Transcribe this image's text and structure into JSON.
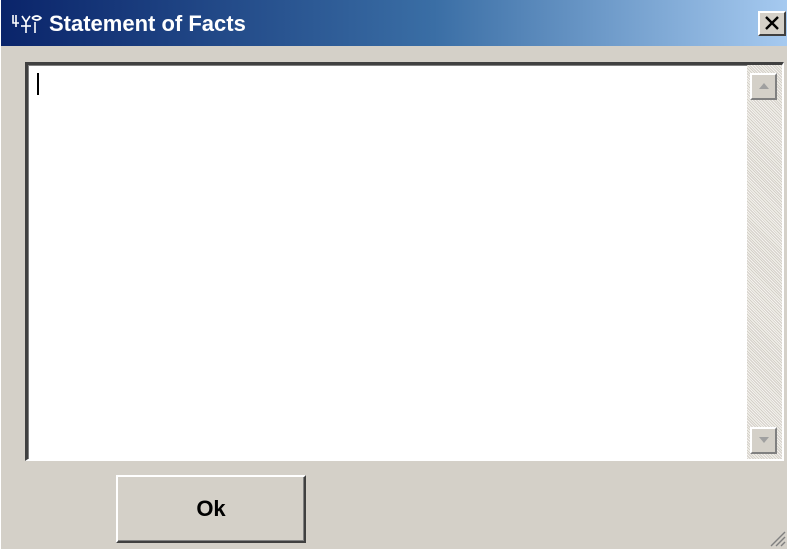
{
  "window": {
    "title": "Statement of Facts",
    "app_icon": "application-logo-icon",
    "close_icon": "close-icon"
  },
  "editor": {
    "value": "",
    "scroll_up_icon": "scroll-up-arrow-icon",
    "scroll_down_icon": "scroll-down-arrow-icon"
  },
  "actions": {
    "ok_label": "Ok"
  },
  "colors": {
    "titlebar_start": "#0a246a",
    "titlebar_end": "#a6caf0",
    "window_face": "#d4d0c8"
  }
}
